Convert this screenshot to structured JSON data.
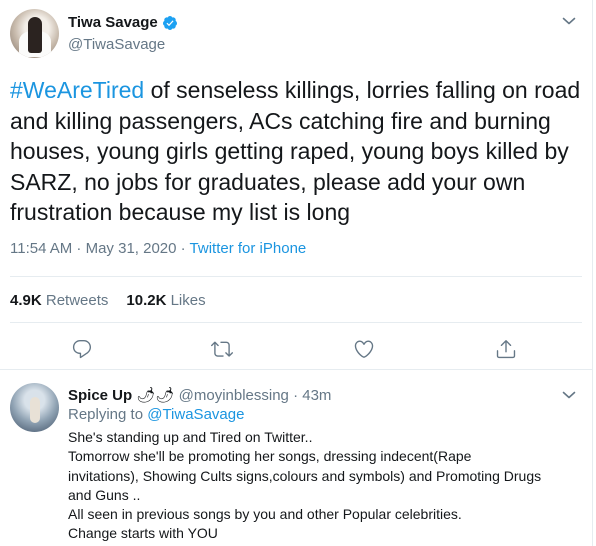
{
  "tweet": {
    "author_name": "Tiwa Savage",
    "author_handle": "@TiwaSavage",
    "hashtag": "#WeAreTired",
    "text": " of senseless killings, lorries falling on road and killing passengers, ACs catching fire and burning houses, young girls getting raped, young boys killed by SARZ, no jobs for graduates, please add your own frustration because my list is long",
    "time": "11:54 AM · May 31, 2020 · ",
    "source": "Twitter for iPhone",
    "retweets_count": "4.9K",
    "retweets_label": "Retweets",
    "likes_count": "10.2K",
    "likes_label": "Likes"
  },
  "reply": {
    "author_name": "Spice Up",
    "author_emoji": "🌶🌶",
    "author_handle": "@moyinblessing",
    "time": " · 43m",
    "replying_prefix": "Replying to ",
    "replying_to": "@TiwaSavage",
    "lines": [
      "She's standing up and Tired on Twitter..",
      "Tomorrow she'll be promoting her songs, dressing indecent(Rape",
      "invitations), Showing Cults signs,colours and symbols) and Promoting Drugs",
      "and Guns ..",
      "All seen in previous songs by you and other Popular celebrities.",
      "Change starts with YOU"
    ]
  },
  "icons": {
    "verified": "verified-badge-icon",
    "chevron": "chevron-down-icon",
    "reply": "reply-icon",
    "retweet": "retweet-icon",
    "like": "heart-icon",
    "share": "share-icon"
  },
  "colors": {
    "accent": "#1b95e0",
    "secondary_text": "#657786",
    "border": "#e6ecf0",
    "primary_text": "#14171a"
  }
}
